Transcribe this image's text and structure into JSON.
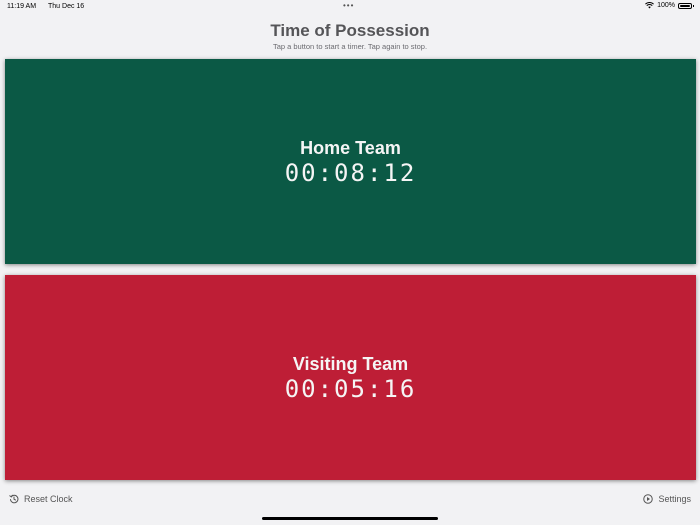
{
  "status_bar": {
    "time": "11:19 AM",
    "date": "Thu Dec 16",
    "battery": "100%",
    "icons": [
      "wifi-icon",
      "battery-icon"
    ]
  },
  "header": {
    "title": "Time of Possession",
    "subtitle": "Tap a button to start a timer. Tap again to stop."
  },
  "teams": [
    {
      "name": "Home Team",
      "time": "00:08:12",
      "color": "#0b5945"
    },
    {
      "name": "Visiting Team",
      "time": "00:05:16",
      "color": "#be1e36"
    }
  ],
  "footer": {
    "reset_label": "Reset Clock",
    "reset_icon": "history-icon",
    "settings_label": "Settings",
    "settings_icon": "play-circle-icon"
  },
  "colors": {
    "background": "#f2f2f4",
    "title": "#555558"
  }
}
